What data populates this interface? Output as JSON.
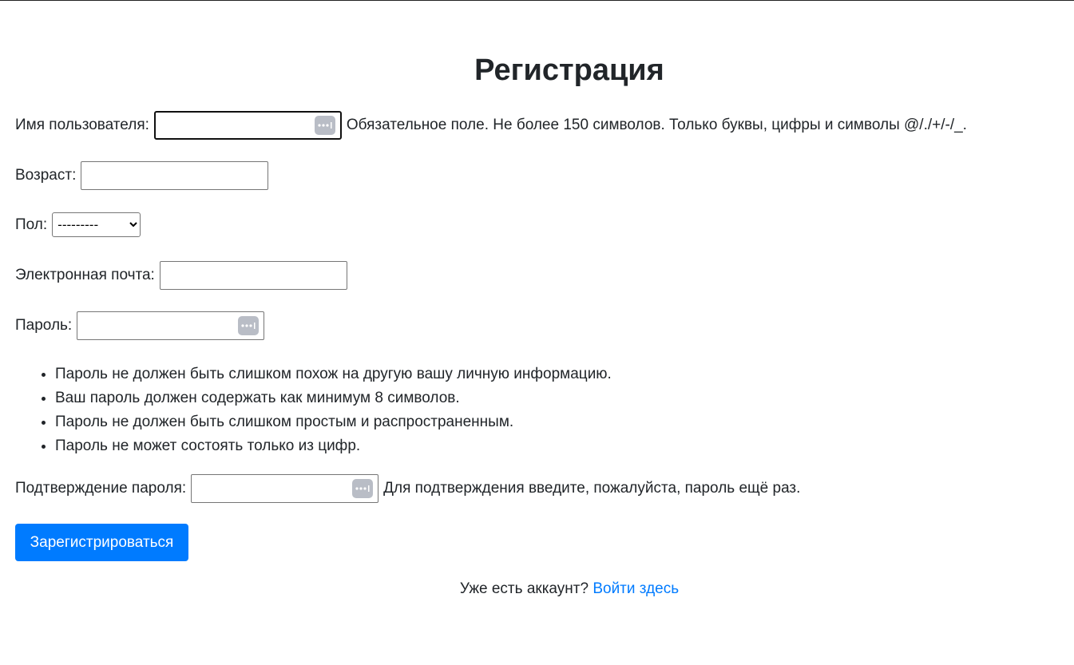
{
  "page": {
    "title": "Регистрация"
  },
  "form": {
    "username": {
      "label": "Имя пользователя:",
      "value": "",
      "help": "Обязательное поле. Не более 150 символов. Только буквы, цифры и символы @/./+/-/_."
    },
    "age": {
      "label": "Возраст:",
      "value": ""
    },
    "gender": {
      "label": "Пол:",
      "selected": "---------"
    },
    "email": {
      "label": "Электронная почта:",
      "value": ""
    },
    "password": {
      "label": "Пароль:",
      "value": "",
      "rules": [
        "Пароль не должен быть слишком похож на другую вашу личную информацию.",
        "Ваш пароль должен содержать как минимум 8 символов.",
        "Пароль не должен быть слишком простым и распространенным.",
        "Пароль не может состоять только из цифр."
      ]
    },
    "password_confirm": {
      "label": "Подтверждение пароля:",
      "value": "",
      "help": "Для подтверждения введите, пожалуйста, пароль ещё раз."
    },
    "submit_label": "Зарегистрироваться"
  },
  "login": {
    "prompt": "Уже есть аккаунт?",
    "link_label": "Войти здесь"
  },
  "colors": {
    "primary": "#007bff",
    "text": "#212529",
    "password_icon": "#b9bdc6"
  },
  "icons": {
    "password_manager": "password-manager-icon"
  }
}
